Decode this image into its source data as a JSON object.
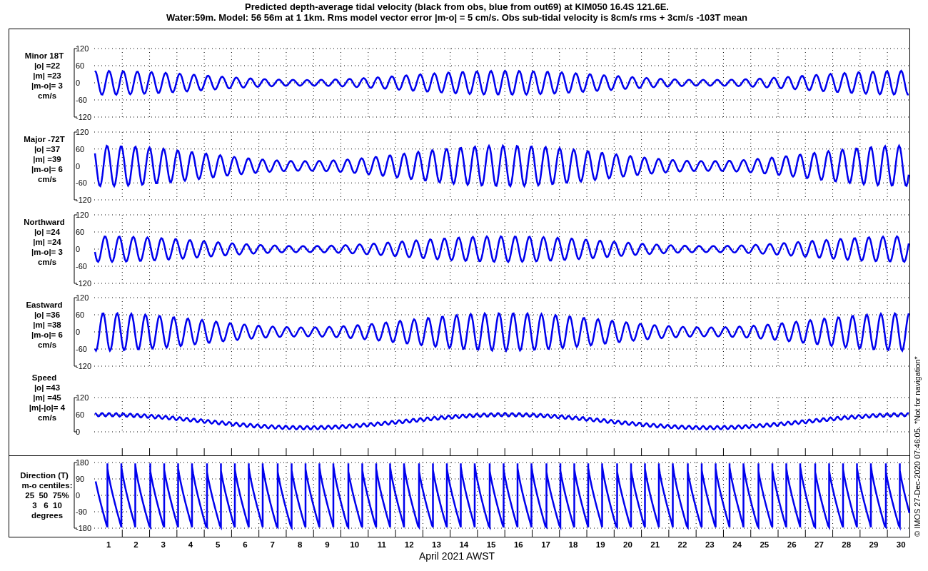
{
  "title": {
    "line_1": "Predicted depth-average tidal velocity (black from obs, blue from out69) at KIM050 16.4S 121.6E.",
    "line_2": "Water:59m. Model: 56 56m at 1 1km. Rms model vector error |m-o| = 5 cm/s. Obs sub-tidal velocity is 8cm/s rms + 3cm/s -103T mean"
  },
  "panels": [
    {
      "kind": "wave",
      "label": [
        "Minor 18T",
        "|o| =22",
        "|m| =23",
        "|m-o|= 3",
        "cm/s"
      ],
      "yticks": [
        "120",
        "60",
        "0",
        "-60",
        "-120"
      ]
    },
    {
      "kind": "wave",
      "label": [
        "Major -72T",
        "|o| =37",
        "|m| =39",
        "|m-o|= 6",
        "cm/s"
      ],
      "yticks": [
        "120",
        "60",
        "0",
        "-60",
        "-120"
      ]
    },
    {
      "kind": "wave",
      "label": [
        "Northward",
        "|o| =24",
        "|m| =24",
        "|m-o|= 3",
        "cm/s"
      ],
      "yticks": [
        "120",
        "60",
        "0",
        "-60",
        "-120"
      ]
    },
    {
      "kind": "wave",
      "label": [
        "Eastward",
        "|o| =36",
        "|m| =38",
        "|m-o|= 6",
        "cm/s"
      ],
      "yticks": [
        "120",
        "60",
        "0",
        "-60",
        "-120"
      ]
    },
    {
      "kind": "speed",
      "label": [
        "Speed",
        "|o| =43",
        "|m| =45",
        "|m|-|o|= 4",
        "cm/s"
      ],
      "yticks": [
        "120",
        "60",
        "0"
      ]
    },
    {
      "kind": "direction",
      "label": [
        "Direction (T)",
        "m-o centiles:",
        "25  50  75%",
        "3   6  10",
        "degrees"
      ],
      "yticks": [
        "180",
        "90",
        "0",
        "-90",
        "-180"
      ]
    }
  ],
  "x_axis": {
    "ticks": [
      "1",
      "2",
      "3",
      "4",
      "5",
      "6",
      "7",
      "8",
      "9",
      "10",
      "11",
      "12",
      "13",
      "14",
      "15",
      "16",
      "17",
      "18",
      "19",
      "20",
      "21",
      "22",
      "23",
      "24",
      "25",
      "26",
      "27",
      "28",
      "29",
      "30"
    ],
    "label": "April 2021 AWST"
  },
  "credit": "© IMOS 27-Dec-2020 07:46:05.  *Not for navigation*"
}
